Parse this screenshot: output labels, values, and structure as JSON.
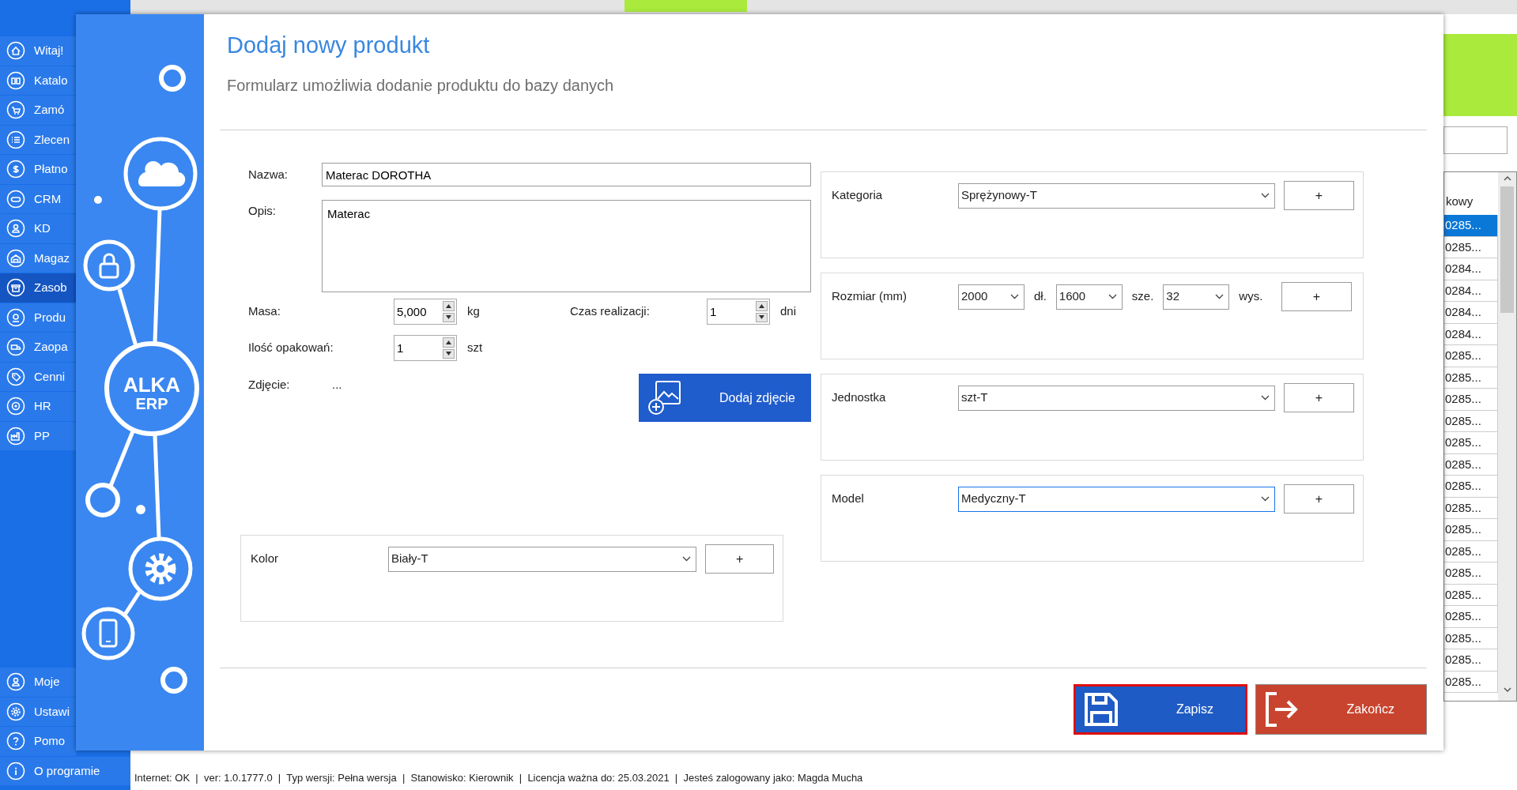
{
  "sidebar": {
    "items": [
      {
        "label": "Witaj!",
        "selected": false
      },
      {
        "label": "Katalo",
        "selected": false
      },
      {
        "label": "Zamó",
        "selected": false
      },
      {
        "label": "Zlecen",
        "selected": false
      },
      {
        "label": "Płatno",
        "selected": false
      },
      {
        "label": "CRM",
        "selected": false
      },
      {
        "label": "KD",
        "selected": false
      },
      {
        "label": "Magaz",
        "selected": false
      },
      {
        "label": "Zasob",
        "selected": true
      },
      {
        "label": "Produ",
        "selected": false
      },
      {
        "label": "Zaopa",
        "selected": false
      },
      {
        "label": "Cenni",
        "selected": false
      },
      {
        "label": "HR",
        "selected": false
      },
      {
        "label": "PP",
        "selected": false
      }
    ],
    "bottom_items": [
      {
        "label": "Moje"
      },
      {
        "label": "Ustawi"
      },
      {
        "label": "Pomo"
      },
      {
        "label": "O programie"
      }
    ]
  },
  "list": {
    "header": "kowy",
    "rows": [
      {
        "text": "0285...",
        "selected": true
      },
      {
        "text": "0285...",
        "selected": false
      },
      {
        "text": "0284...",
        "selected": false
      },
      {
        "text": "0284...",
        "selected": false
      },
      {
        "text": "0284...",
        "selected": false
      },
      {
        "text": "0284...",
        "selected": false
      },
      {
        "text": "0285...",
        "selected": false
      },
      {
        "text": "0285...",
        "selected": false
      },
      {
        "text": "0285...",
        "selected": false
      },
      {
        "text": "0285...",
        "selected": false
      },
      {
        "text": "0285...",
        "selected": false
      },
      {
        "text": "0285...",
        "selected": false
      },
      {
        "text": "0285...",
        "selected": false
      },
      {
        "text": "0285...",
        "selected": false
      },
      {
        "text": "0285...",
        "selected": false
      },
      {
        "text": "0285...",
        "selected": false
      },
      {
        "text": "0285...",
        "selected": false
      },
      {
        "text": "0285...",
        "selected": false
      },
      {
        "text": "0285...",
        "selected": false
      },
      {
        "text": "0285...",
        "selected": false
      },
      {
        "text": "0285...",
        "selected": false
      },
      {
        "text": "0285...",
        "selected": false
      }
    ]
  },
  "dialog": {
    "logo_lines": [
      "ALKA",
      "ERP"
    ],
    "title": "Dodaj nowy produkt",
    "subtitle": "Formularz umożliwia dodanie produktu do bazy danych",
    "name": {
      "label": "Nazwa:",
      "value": "Materac DOROTHA"
    },
    "description": {
      "label": "Opis:",
      "value": "Materac"
    },
    "mass": {
      "label": "Masa:",
      "value": "5,000",
      "unit": "kg"
    },
    "lead_time": {
      "label": "Czas realizacji:",
      "value": "1",
      "unit": "dni"
    },
    "packages": {
      "label": "Ilość opakowań:",
      "value": "1",
      "unit": "szt"
    },
    "photo": {
      "label": "Zdjęcie:",
      "value": "...",
      "button": "Dodaj zdjęcie"
    },
    "color_group": {
      "label": "Kolor",
      "value": "Biały-T",
      "add": "+",
      "focused": false
    },
    "groups": [
      {
        "kind": "combo",
        "label": "Kategoria",
        "value": "Sprężynowy-T",
        "add": "+",
        "focused": false
      },
      {
        "kind": "size",
        "label": "Rozmiar (mm)",
        "parts": [
          {
            "value": "2000",
            "unit": "dł."
          },
          {
            "value": "1600",
            "unit": "sze."
          },
          {
            "value": "32",
            "unit": "wys."
          }
        ],
        "add": "+"
      },
      {
        "kind": "combo",
        "label": "Jednostka",
        "value": "szt-T",
        "add": "+",
        "focused": false
      },
      {
        "kind": "combo",
        "label": "Model",
        "value": "Medyczny-T",
        "add": "+",
        "focused": true
      }
    ],
    "buttons": [
      {
        "kind": "save",
        "label": "Zapisz",
        "focused": true
      },
      {
        "kind": "exit",
        "label": "Zakończ",
        "focused": false
      }
    ]
  },
  "status_bar": "Internet: OK  |  ver: 1.0.1777.0  |  Typ wersji: Pełna wersja  |  Stanowisko: Kierownik  |  Licencja ważna do: 25.03.2021  |  Jesteś zalogowany jako: Magda Mucha"
}
